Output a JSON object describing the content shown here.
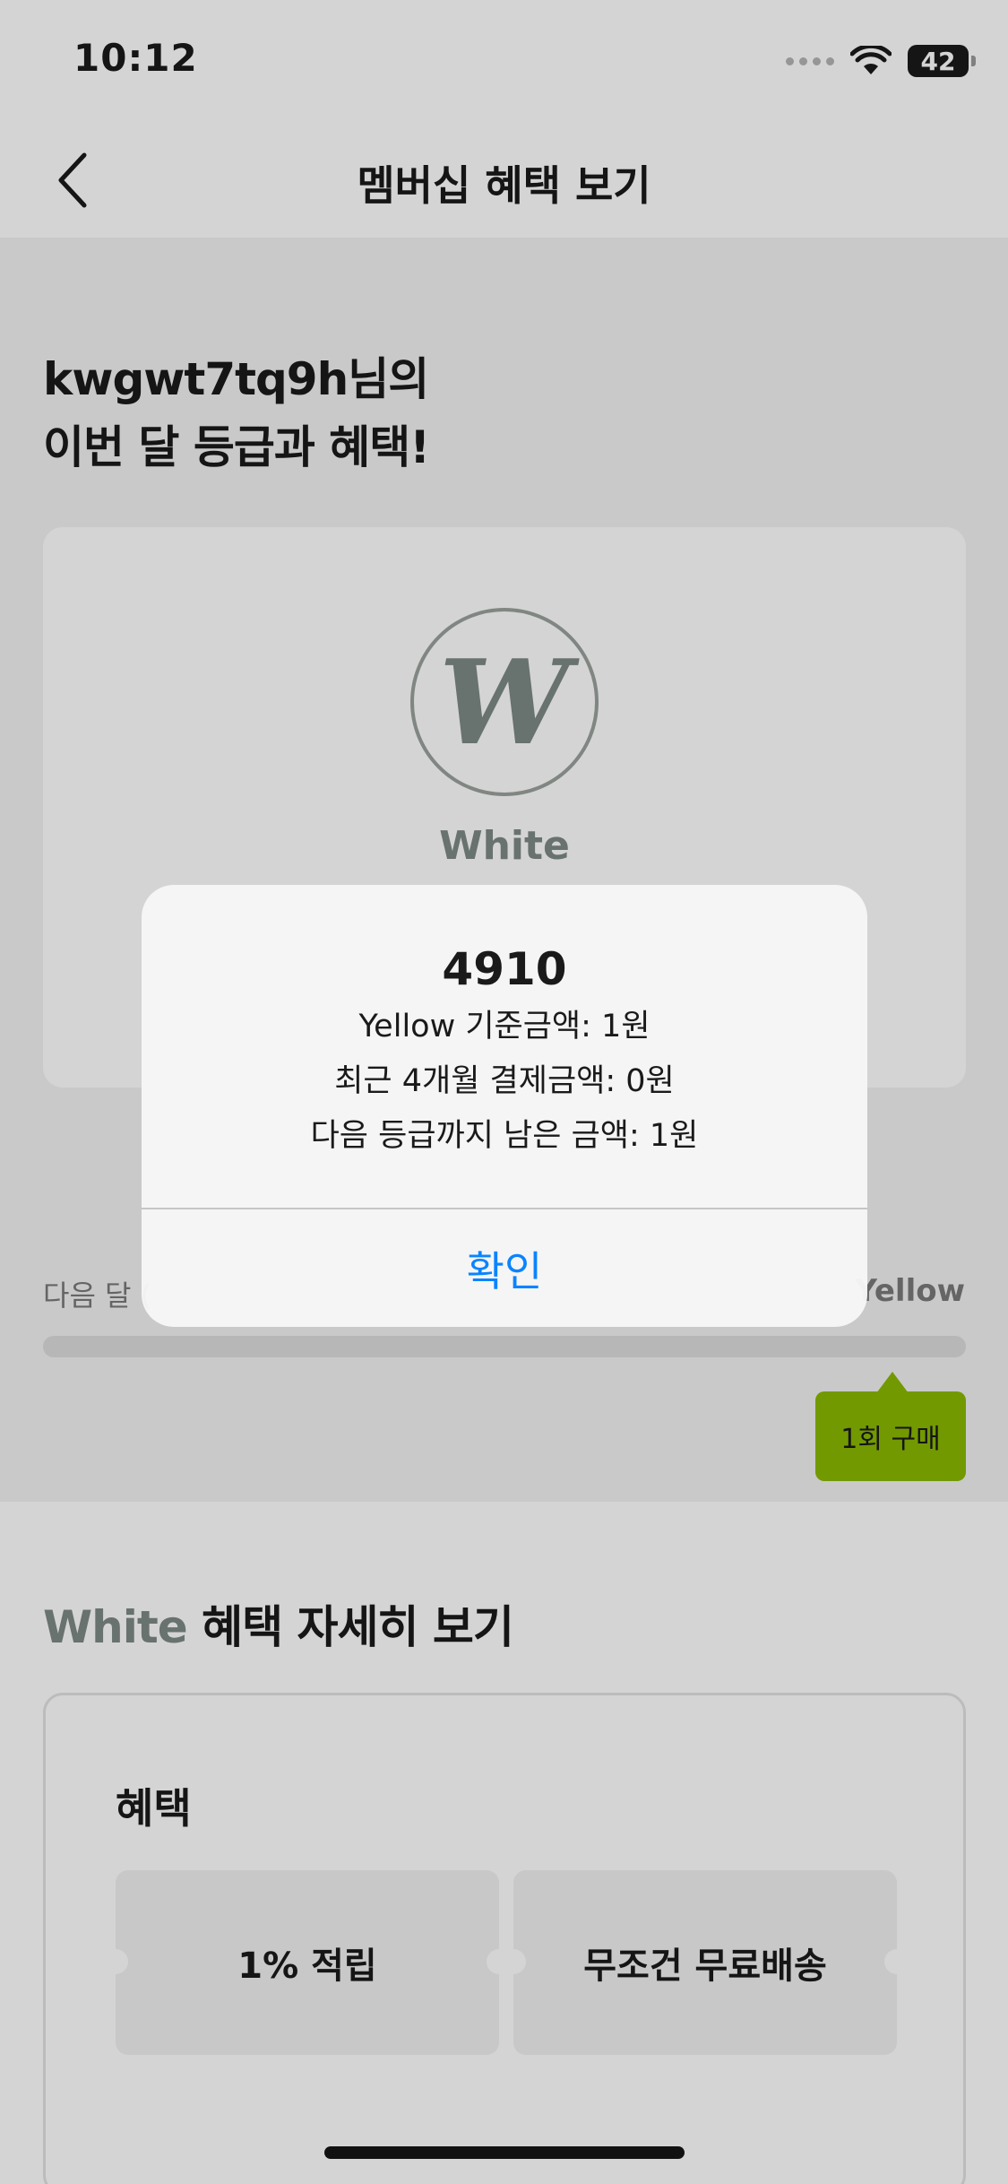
{
  "status_bar": {
    "time": "10:12",
    "battery": "42"
  },
  "nav": {
    "title": "멤버십 혜택 보기"
  },
  "greeting": {
    "line1": "kwgwt7tq9h님의",
    "line2": "이번 달 등급과 혜택!"
  },
  "grade_card": {
    "badge_letter": "W",
    "grade_name": "White"
  },
  "progress": {
    "label_left": "다음 달 (",
    "label_right": "Yellow",
    "tooltip": "1회 구매",
    "fill_percent": 0
  },
  "benefits": {
    "title_grade": "White",
    "title_rest": " 혜택 자세히 보기",
    "heading": "혜택",
    "items": [
      "1% 적립",
      "무조건 무료배송"
    ]
  },
  "alert": {
    "title": "4910",
    "lines": [
      "Yellow 기준금액: 1원",
      "최근 4개월 결제금액: 0원",
      "다음 등급까지 남은 금액: 1원"
    ],
    "confirm_label": "확인"
  },
  "colors": {
    "accent_green": "#8ab800",
    "grade_gray": "#7e8a85",
    "ios_blue": "#0a84ff"
  }
}
